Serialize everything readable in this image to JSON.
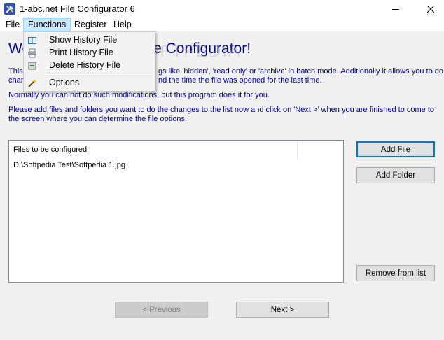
{
  "window": {
    "title": "1-abc.net File Configurator 6",
    "controls": {
      "minimize": "minimize-icon",
      "close": "close-icon"
    }
  },
  "menubar": {
    "items": [
      {
        "label": "File"
      },
      {
        "label": "Functions"
      },
      {
        "label": "Register"
      },
      {
        "label": "Help"
      }
    ],
    "active": "Functions"
  },
  "functions_menu": {
    "items": [
      {
        "label": "Show History File",
        "icon": "book-icon"
      },
      {
        "label": "Print History File",
        "icon": "printer-icon"
      },
      {
        "label": "Delete History File",
        "icon": "delete-file-icon"
      },
      {
        "label": "Options",
        "icon": "magic-wand-icon"
      }
    ]
  },
  "main": {
    "welcome_left": "We",
    "welcome_right": "e Configurator!",
    "para1_line1_left": "This",
    "para1_line1_right": "gs like 'hidden', 'read only' or 'archive' in batch mode. Additionally it allows you to do",
    "para1_line2_left": "chan",
    "para1_line2_right": "nd the time the file was opened for the last time.",
    "para2": "Normally you can not do such modifications, but this program does it for you.",
    "para3_line1": "Please add files and folders you want to do the changes to the list now and click on 'Next >' when you are finished to come to",
    "para3_line2": "the screen where you can determine the file options.",
    "watermark": "SOFTPEDIA"
  },
  "file_list": {
    "header": "Files to be configured:",
    "rows": [
      "D:\\Softpedia Test\\Softpedia 1.jpg"
    ]
  },
  "buttons": {
    "add_file": "Add File",
    "add_folder": "Add Folder",
    "remove": "Remove from list",
    "previous": "< Previous",
    "next": "Next >"
  },
  "colors": {
    "text_blue": "#00008b",
    "menu_highlight": "#cce8ff",
    "default_button_border": "#0078d7"
  }
}
